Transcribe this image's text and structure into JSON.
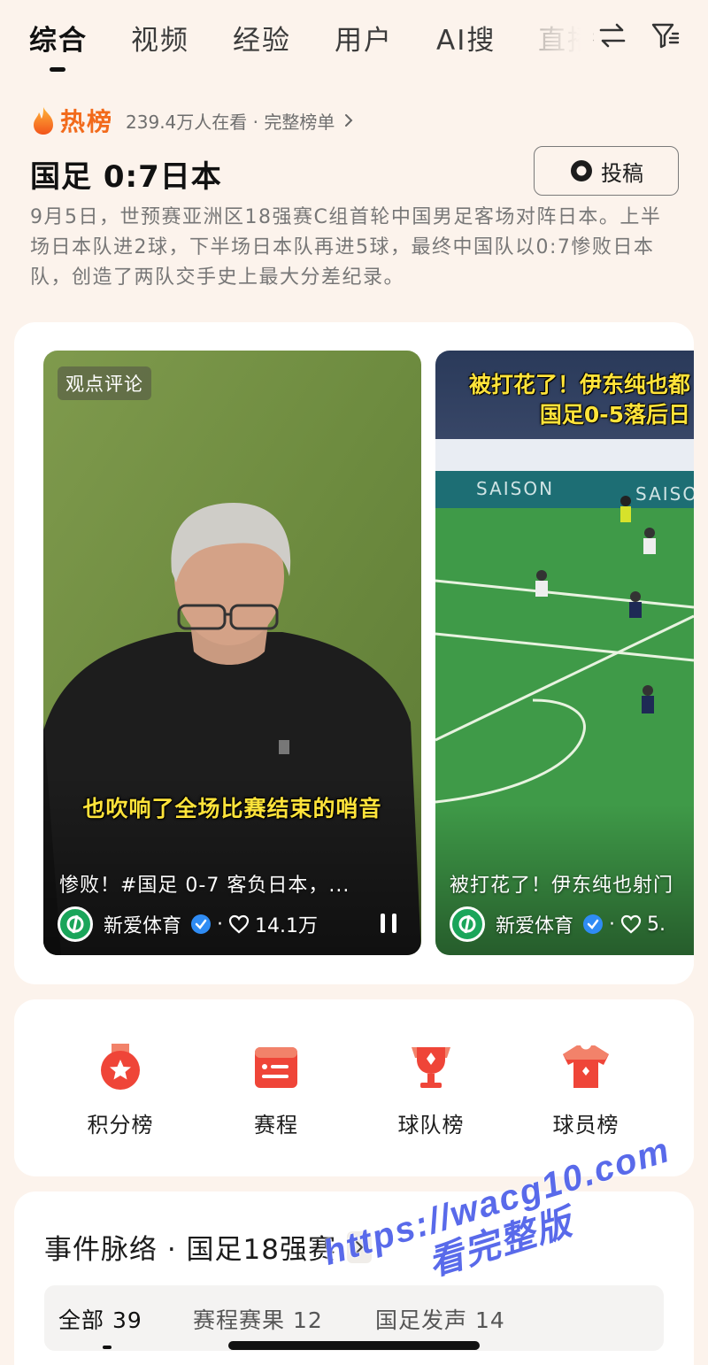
{
  "tabs": {
    "items": [
      "综合",
      "视频",
      "经验",
      "用户",
      "AI搜",
      "直播"
    ],
    "active": "综合"
  },
  "hot": {
    "label": "热榜",
    "meta": "239.4万人在看 · 完整榜单"
  },
  "headline": {
    "title": "国足 0:7日本",
    "submit_label": "投稿",
    "summary": "9月5日，世预赛亚洲区18强赛C组首轮中国男足客场对阵日本。上半场日本队进2球，下半场日本队再进5球，最终中国队以0:7惨败日本队，创造了两队交手史上最大分差纪录。"
  },
  "videos": [
    {
      "badge": "观点评论",
      "subtitle": "也吹响了全场比赛结束的哨音",
      "title": "惨败！#国足 0-7 客负日本，...",
      "author": "新爱体育",
      "likes": "14.1万"
    },
    {
      "caption_line1": "被打花了！伊东纯也都",
      "caption_line2": "国足0-5落后日",
      "board_text": "SAISON",
      "title": "被打花了！伊东纯也射门",
      "author": "新爱体育",
      "likes": "5."
    }
  ],
  "rankings": [
    {
      "label": "积分榜",
      "icon": "medal-icon"
    },
    {
      "label": "赛程",
      "icon": "schedule-icon"
    },
    {
      "label": "球队榜",
      "icon": "trophy-icon"
    },
    {
      "label": "球员榜",
      "icon": "jersey-icon"
    }
  ],
  "events": {
    "title": "事件脉络 · 国足18强赛",
    "filters": [
      "全部 39",
      "赛程赛果 12",
      "国足发声 14"
    ]
  },
  "watermark": {
    "line1": "https://wacg10.com",
    "line2": "看完整版"
  },
  "colors": {
    "background": "#fcf3ec",
    "hot_orange": "#f26a1b",
    "subtitle_yellow": "#ffe33a",
    "icon_red": "#ef4538",
    "avatar_green": "#1aa55a",
    "verified_blue": "#2f8cf4"
  }
}
